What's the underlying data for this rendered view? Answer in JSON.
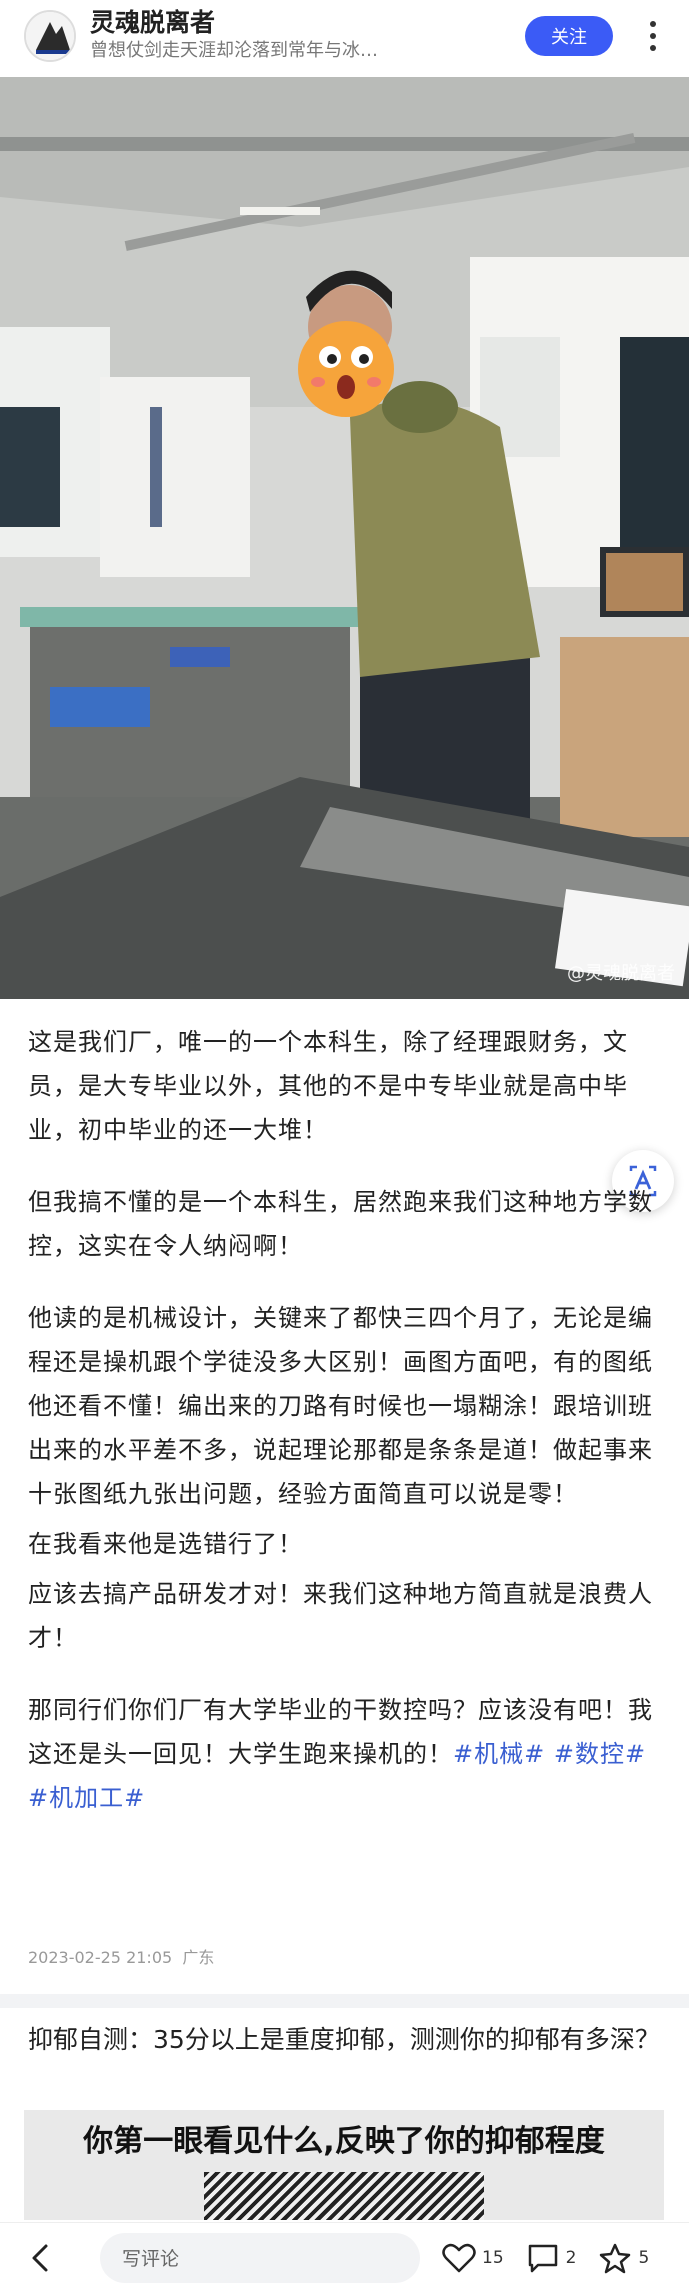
{
  "header": {
    "user_name": "灵魂脱离者",
    "signature": "曾想仗剑走天涯却沦落到常年与冰…",
    "follow_label": "关注"
  },
  "photo": {
    "watermark": "@灵魂脱离者"
  },
  "post": {
    "paragraphs": [
      "这是我们厂，唯一的一个本科生，除了经理跟财务，文员，是大专毕业以外，其他的不是中专毕业就是高中毕业，初中毕业的还一大堆！",
      "但我搞不懂的是一个本科生，居然跑来我们这种地方学数控，这实在令人纳闷啊！",
      "他读的是机械设计，关键来了都快三四个月了，无论是编程还是操机跟个学徒没多大区别！画图方面吧，有的图纸他还看不懂！编出来的刀路有时候也一塌糊涂！跟培训班出来的水平差不多，说起理论那都是条条是道！做起事来十张图纸九张出问题，经验方面简直可以说是零！",
      "在我看来他是选错行了！",
      "应该去搞产品研发才对！来我们这种地方简直就是浪费人才！"
    ],
    "last_paragraph": "那同行们你们厂有大学毕业的干数控吗？应该没有吧！我这还是头一回见！大学生跑来操机的！",
    "tags": [
      "#机械#",
      "#数控#",
      "#机加工#"
    ],
    "date": "2023-02-25 21:05",
    "location": "广东"
  },
  "ad": {
    "title": "抑郁自测：35分以上是重度抑郁，测测你的抑郁有多深？",
    "banner_text": "你第一眼看见什么,反映了你的抑郁程度"
  },
  "bottom_bar": {
    "comment_placeholder": "写评论",
    "like_count": "15",
    "comment_count": "2",
    "star_count": "5"
  },
  "colors": {
    "accent": "#3b5bf6",
    "tag": "#3a5fd1"
  }
}
